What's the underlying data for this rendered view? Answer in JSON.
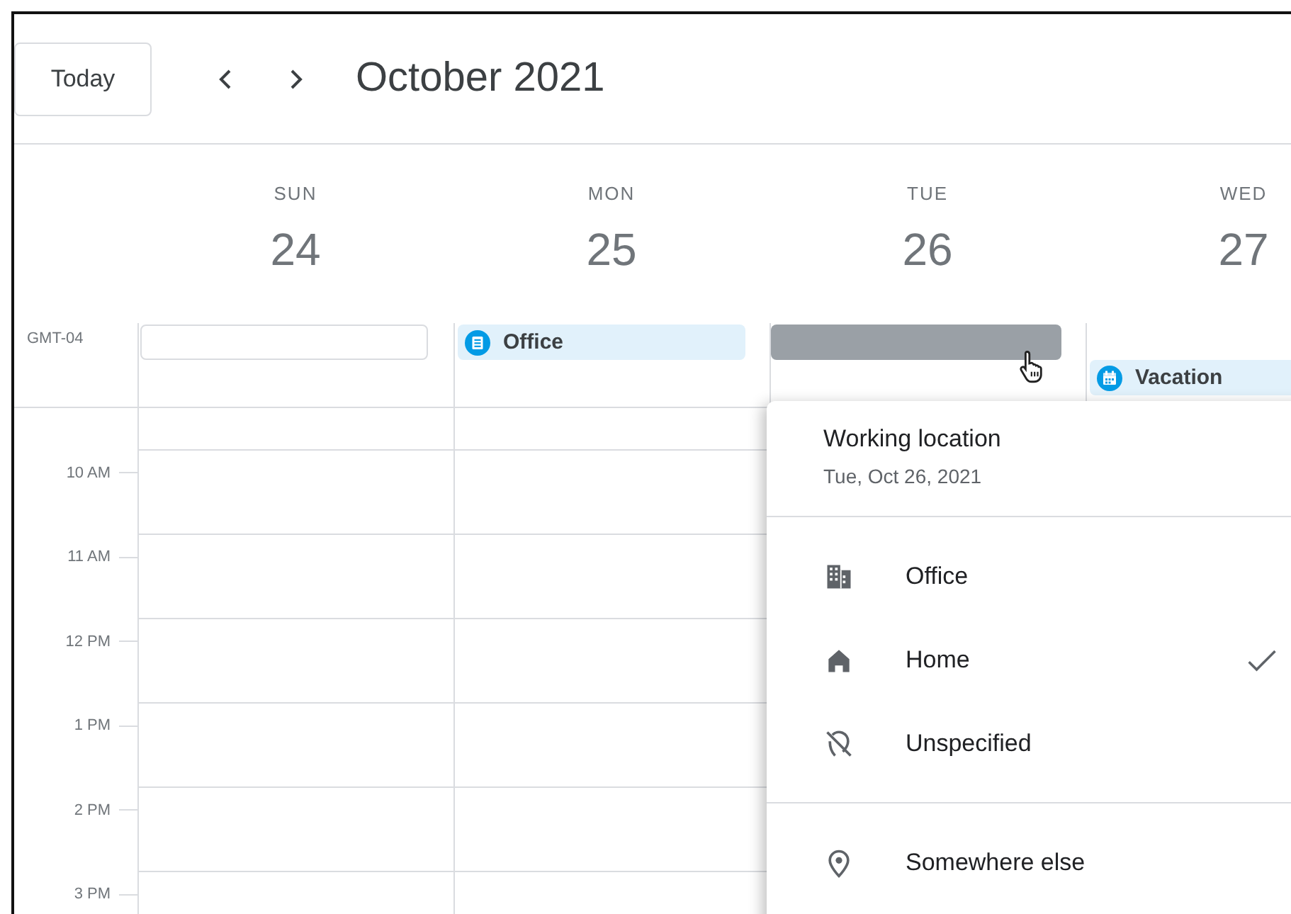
{
  "toolbar": {
    "today_button": "Today",
    "title": "October 2021"
  },
  "timezone": "GMT-04",
  "days": [
    {
      "weekday": "SUN",
      "date": "24",
      "all_day": {
        "kind": "empty"
      }
    },
    {
      "weekday": "MON",
      "date": "25",
      "all_day": {
        "kind": "location",
        "label": "Office"
      }
    },
    {
      "weekday": "TUE",
      "date": "26",
      "all_day": {
        "kind": "selected"
      }
    },
    {
      "weekday": "WED",
      "date": "27",
      "all_day": {
        "kind": "event",
        "label": "Vacation"
      }
    }
  ],
  "hours": [
    "10 AM",
    "11 AM",
    "12 PM",
    "1 PM",
    "2 PM",
    "3 PM"
  ],
  "popup": {
    "title": "Working location",
    "date": "Tue, Oct 26, 2021",
    "options": [
      {
        "kind": "building",
        "label": "Office",
        "selected": false
      },
      {
        "kind": "home",
        "label": "Home",
        "selected": true
      },
      {
        "kind": "no-location",
        "label": "Unspecified",
        "selected": false
      }
    ],
    "other": {
      "kind": "pin",
      "label": "Somewhere else"
    }
  }
}
